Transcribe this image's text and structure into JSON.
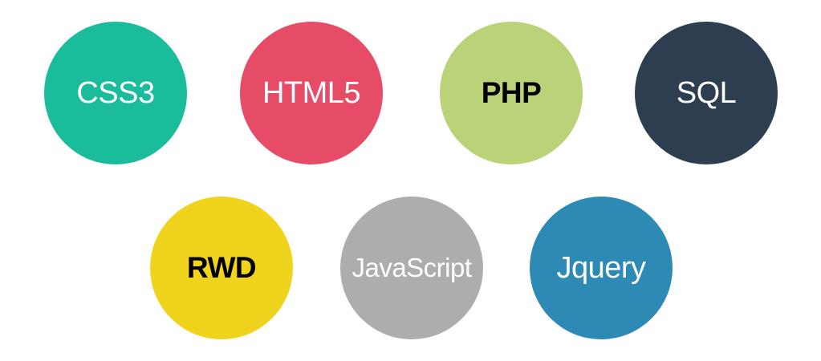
{
  "skills": [
    {
      "id": "css3",
      "label": "CSS3",
      "bg": "#1ABC9C",
      "fg": "#FFFFFF"
    },
    {
      "id": "html5",
      "label": "HTML5",
      "bg": "#E74C67",
      "fg": "#FFFFFF"
    },
    {
      "id": "php",
      "label": "PHP",
      "bg": "#BBD378",
      "fg": "#000000"
    },
    {
      "id": "sql",
      "label": "SQL",
      "bg": "#2C3E50",
      "fg": "#FFFFFF"
    },
    {
      "id": "rwd",
      "label": "RWD",
      "bg": "#F0D31C",
      "fg": "#000000"
    },
    {
      "id": "js",
      "label": "JavaScript",
      "bg": "#ADADAD",
      "fg": "#FFFFFF"
    },
    {
      "id": "jquery",
      "label": "Jquery",
      "bg": "#2C8AB5",
      "fg": "#FFFFFF"
    }
  ]
}
